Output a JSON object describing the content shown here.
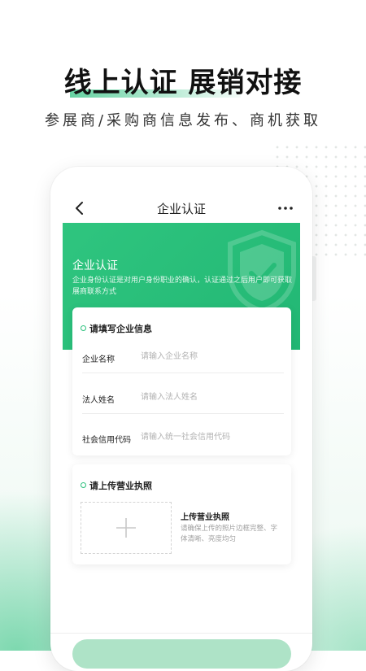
{
  "promo": {
    "headline": "线上认证 展销对接",
    "subline": "参展商/采购商信息发布、商机获取"
  },
  "header": {
    "title": "企业认证"
  },
  "banner": {
    "title": "企业认证",
    "description": "企业身份认证是对用户身份职业的确认，认证通过之后用户即可获取展商联系方式"
  },
  "info_section": {
    "title": "请填写企业信息",
    "fields": [
      {
        "label": "企业名称",
        "placeholder": "请输入企业名称",
        "value": ""
      },
      {
        "label": "法人姓名",
        "placeholder": "请输入法人姓名",
        "value": ""
      },
      {
        "label": "社会信用代码",
        "placeholder": "请输入统一社会信用代码",
        "value": ""
      }
    ]
  },
  "license_section": {
    "title": "请上传营业执照",
    "upload_title": "上传营业执照",
    "upload_desc": "请确保上传的照片边框完整、字体清晰、亮度均匀"
  },
  "colors": {
    "accent": "#24bf7a",
    "submit_disabled": "#aee3c7"
  },
  "icons": [
    "back-icon",
    "more-icon",
    "shield-check-icon",
    "plus-icon"
  ]
}
